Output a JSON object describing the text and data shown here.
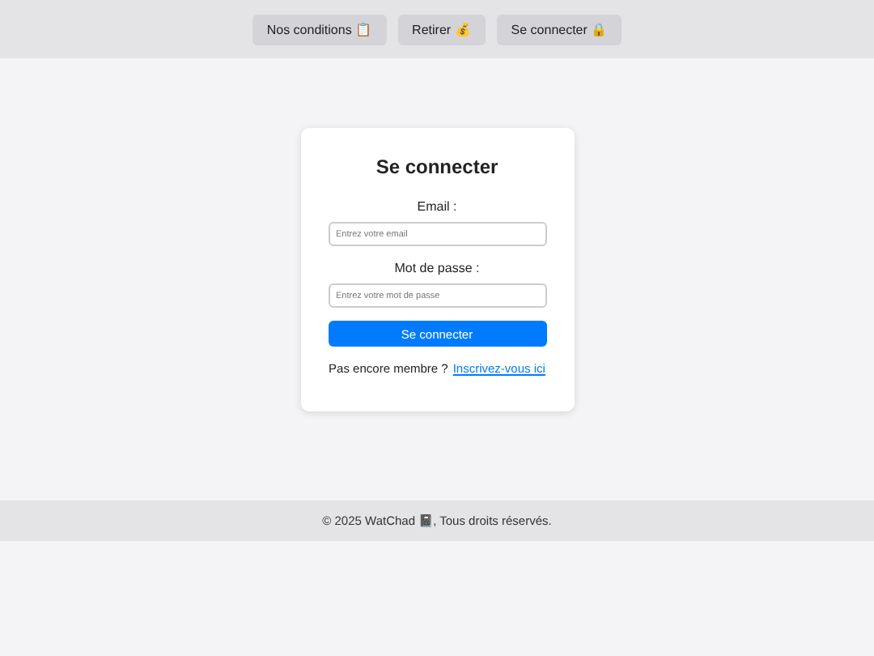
{
  "nav": [
    {
      "label": "Nos conditions 📋"
    },
    {
      "label": "Retirer 💰"
    },
    {
      "label": "Se connecter 🔒"
    }
  ],
  "login": {
    "title": "Se connecter",
    "fields": [
      {
        "label": "Email :",
        "placeholder": "Entrez votre email"
      },
      {
        "label": "Mot de passe :",
        "placeholder": "Entrez votre mot de passe"
      }
    ],
    "submit": "Se connecter",
    "signup_prompt": "Pas encore membre ?",
    "signup_link": "Inscrivez-vous ici"
  },
  "footer": "© 2025 WatChad 📓, Tous droits réservés."
}
